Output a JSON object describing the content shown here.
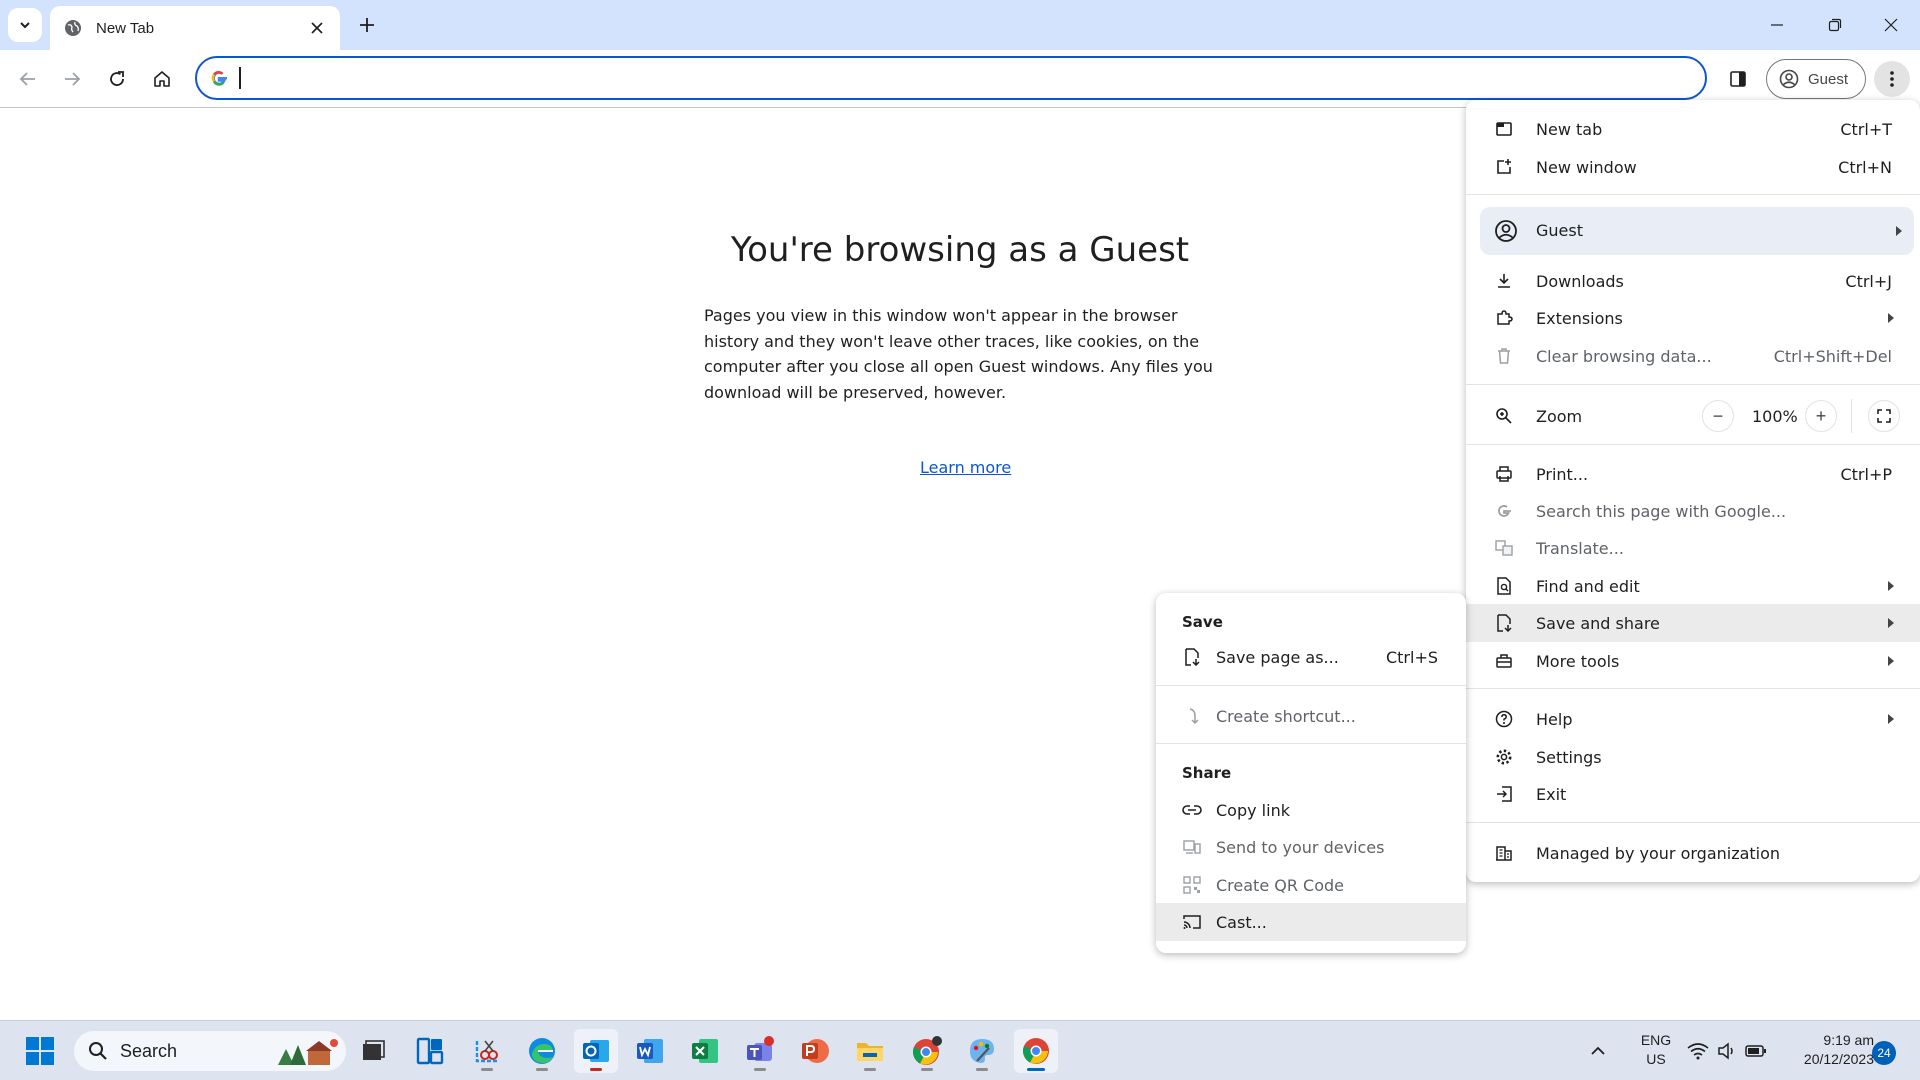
{
  "tab": {
    "title": "New Tab"
  },
  "toolbar": {
    "omnibox_value": "",
    "profile_label": "Guest"
  },
  "page": {
    "heading": "You're browsing as a Guest",
    "body": "Pages you view in this window won't appear in the browser history and they won't leave other traces, like cookies, on the computer after you close all open Guest windows. Any files you download will be preserved, however.",
    "link": "Learn more"
  },
  "menu": {
    "new_tab": {
      "label": "New tab",
      "shortcut": "Ctrl+T"
    },
    "new_window": {
      "label": "New window",
      "shortcut": "Ctrl+N"
    },
    "guest": {
      "label": "Guest"
    },
    "downloads": {
      "label": "Downloads",
      "shortcut": "Ctrl+J"
    },
    "extensions": {
      "label": "Extensions"
    },
    "clear": {
      "label": "Clear browsing data...",
      "shortcut": "Ctrl+Shift+Del"
    },
    "zoom": {
      "label": "Zoom",
      "value": "100%",
      "minus": "−",
      "plus": "+"
    },
    "print": {
      "label": "Print...",
      "shortcut": "Ctrl+P"
    },
    "search_google": {
      "label": "Search this page with Google..."
    },
    "translate": {
      "label": "Translate..."
    },
    "find_edit": {
      "label": "Find and edit"
    },
    "save_share": {
      "label": "Save and share"
    },
    "more_tools": {
      "label": "More tools"
    },
    "help": {
      "label": "Help"
    },
    "settings": {
      "label": "Settings"
    },
    "exit": {
      "label": "Exit"
    },
    "managed": {
      "label": "Managed by your organization"
    }
  },
  "submenu": {
    "save_heading": "Save",
    "save_page": {
      "label": "Save page as...",
      "shortcut": "Ctrl+S"
    },
    "create_shortcut": {
      "label": "Create shortcut..."
    },
    "share_heading": "Share",
    "copy_link": {
      "label": "Copy link"
    },
    "send_devices": {
      "label": "Send to your devices"
    },
    "qr_code": {
      "label": "Create QR Code"
    },
    "cast": {
      "label": "Cast..."
    }
  },
  "taskbar": {
    "search_label": "Search",
    "lang_1": "ENG",
    "lang_2": "US",
    "time": "9:19 am",
    "date": "20/12/2023",
    "notification_count": "24"
  },
  "colors": {
    "accent": "#0b57d0",
    "tabstrip": "#d3e3fd",
    "menu_highlight": "#ebebeb"
  }
}
